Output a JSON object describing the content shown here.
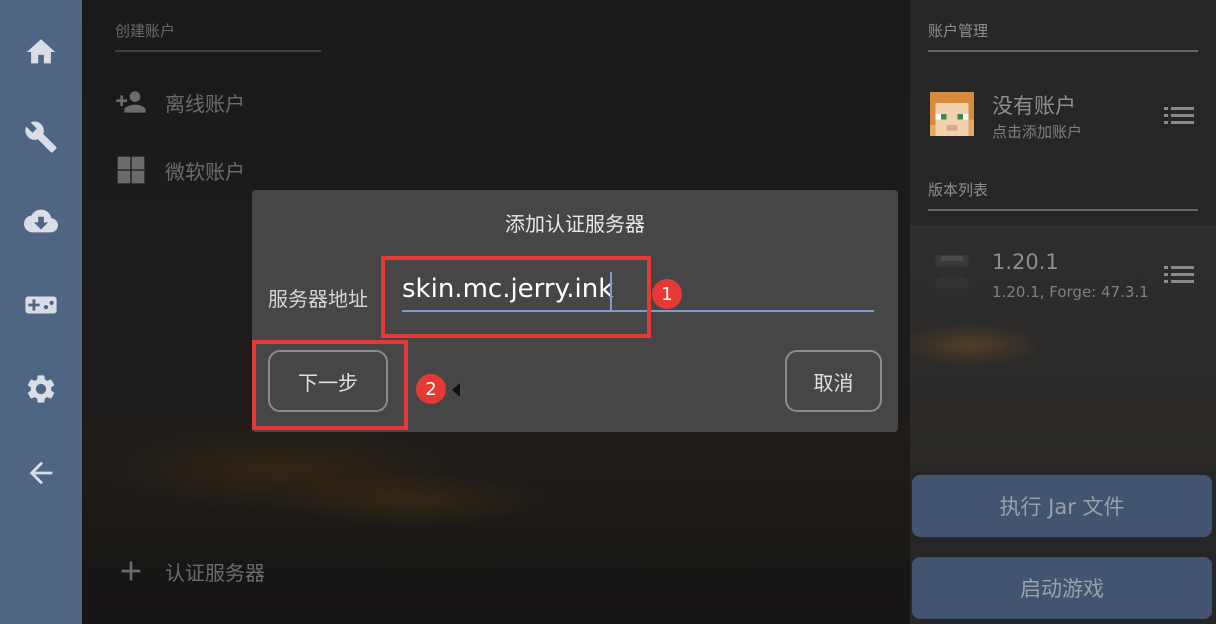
{
  "left_nav": {
    "items": [
      {
        "name": "home-icon"
      },
      {
        "name": "wrench-icon"
      },
      {
        "name": "cloud-download-icon"
      },
      {
        "name": "gamepad-icon"
      },
      {
        "name": "gear-icon"
      },
      {
        "name": "back-arrow-icon"
      }
    ]
  },
  "create_account": {
    "section_title": "创建账户",
    "offline_label": "离线账户",
    "microsoft_label": "微软账户",
    "auth_server_label": "认证服务器"
  },
  "right_panel": {
    "account_title": "账户管理",
    "account_name": "没有账户",
    "account_sub": "点击添加账户",
    "version_title": "版本列表",
    "version_name": "1.20.1",
    "version_sub": "1.20.1, Forge: 47.3.1",
    "run_jar_label": "执行 Jar 文件",
    "launch_label": "启动游戏"
  },
  "dialog": {
    "title": "添加认证服务器",
    "field_label": "服务器地址",
    "field_value": "skin.mc.jerry.ink",
    "next_label": "下一步",
    "cancel_label": "取消"
  },
  "annotations": {
    "badge1": "1",
    "badge2": "2",
    "highlight_color": "#e53935"
  },
  "colors": {
    "nav_bg": "#4f6584",
    "button_bg": "#435470",
    "input_underline": "#7f9bd1",
    "dialog_bg": "#464646"
  }
}
